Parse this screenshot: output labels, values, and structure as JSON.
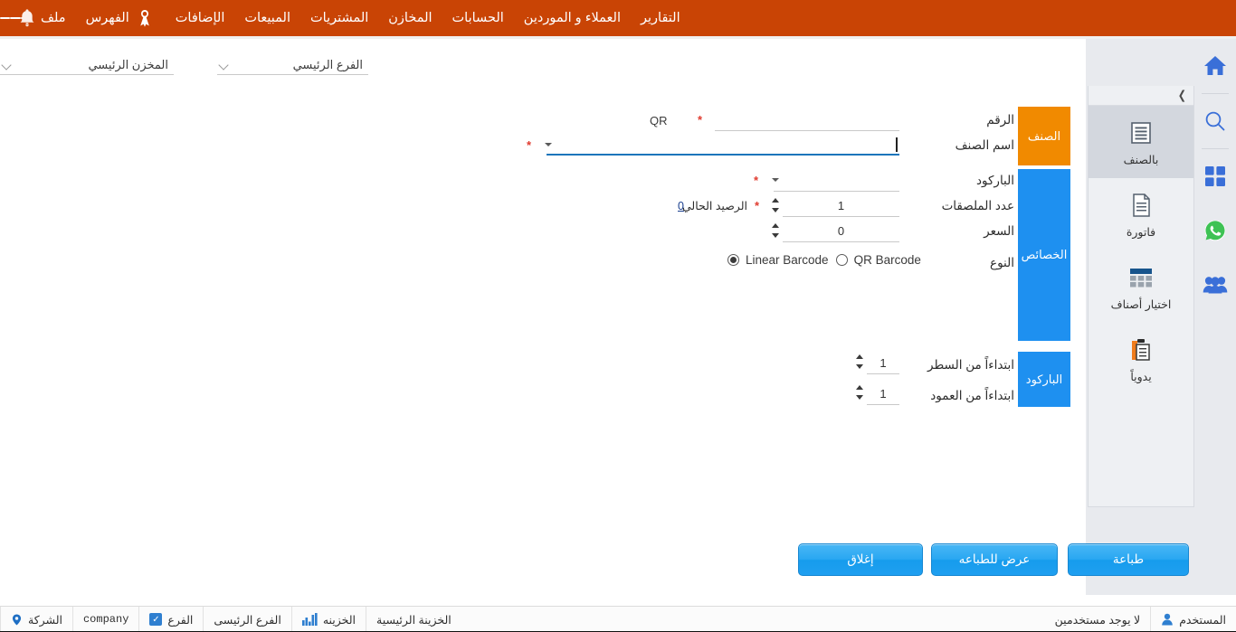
{
  "topbar": {
    "bell_icon": "bell-icon",
    "hamburger_icon": "hamburger-icon",
    "ribbon_icon": "ribbon-icon",
    "menu": [
      {
        "label": "ملف",
        "name": "menu-file"
      },
      {
        "label": "الفهرس",
        "name": "menu-index"
      },
      {
        "label": "الإضافات",
        "name": "menu-addons"
      },
      {
        "label": "المبيعات",
        "name": "menu-sales"
      },
      {
        "label": "المشتريات",
        "name": "menu-purchases"
      },
      {
        "label": "المخازن",
        "name": "menu-warehouses"
      },
      {
        "label": "الحسابات",
        "name": "menu-accounts"
      },
      {
        "label": "العملاء و الموردين",
        "name": "menu-customers-suppliers"
      },
      {
        "label": "التقارير",
        "name": "menu-reports"
      }
    ],
    "bg_color": "#C94405"
  },
  "select_row": {
    "branch": {
      "label": "الفرع الرئيسي",
      "name": "branch-select"
    },
    "store": {
      "label": "المخزن الرئيسي",
      "name": "store-select"
    },
    "third": {
      "label": "",
      "name": "extra-select"
    }
  },
  "tabs": {
    "item": {
      "label": "الصنف",
      "color": "#F18A00"
    },
    "properties": {
      "label": "الخصائص",
      "color": "#1E90F0"
    },
    "barcode": {
      "label": "الباركود",
      "color": "#1E90F0"
    }
  },
  "form": {
    "number": {
      "label": "الرقم",
      "value": "",
      "required": "*"
    },
    "qr_tag": "QR",
    "item_name": {
      "label": "اسم الصنف",
      "value": "",
      "required": "*"
    },
    "barcode": {
      "label": "الباركود",
      "value": "",
      "required": "*"
    },
    "labels_count": {
      "label": "عدد الملصقات",
      "value": "1",
      "required": "*"
    },
    "current_balance": {
      "label": "الرصيد الحالي",
      "value": "0",
      "required": "*"
    },
    "price": {
      "label": "السعر",
      "value": "0"
    },
    "type": {
      "label": "النوع",
      "options": [
        {
          "label": "Linear Barcode",
          "selected": true,
          "name": "radio-linear-barcode"
        },
        {
          "label": "QR Barcode",
          "selected": false,
          "name": "radio-qr-barcode"
        }
      ]
    },
    "start_row": {
      "label": "ابتداءاً من السطر",
      "value": "1"
    },
    "start_col": {
      "label": "ابتداءاً من العمود",
      "value": "1"
    }
  },
  "side_panel": {
    "expand_arrow": "chevron-right-icon",
    "items": [
      {
        "label": "بالصنف",
        "icon": "list-lines-icon",
        "active": true,
        "name": "panel-item-by-item"
      },
      {
        "label": "فاتورة",
        "icon": "document-icon",
        "active": false,
        "name": "panel-item-invoice"
      },
      {
        "label": "اختيار أصناف",
        "icon": "grid-table-icon",
        "active": false,
        "name": "panel-item-select-items"
      },
      {
        "label": "يدوياً",
        "icon": "clipboard-icon",
        "active": false,
        "name": "panel-item-manual"
      }
    ]
  },
  "icon_rail": [
    {
      "icon": "home-icon",
      "name": "rail-home"
    },
    {
      "icon": "search-icon",
      "name": "rail-search"
    },
    {
      "icon": "apps-grid-icon",
      "name": "rail-apps"
    },
    {
      "icon": "whatsapp-icon",
      "name": "rail-whatsapp"
    },
    {
      "icon": "users-icon",
      "name": "rail-users"
    }
  ],
  "buttons": {
    "print": {
      "label": "طباعة",
      "name": "print-button"
    },
    "preview": {
      "label": "عرض للطباعه",
      "name": "print-preview-button"
    },
    "close": {
      "label": "إغلاق",
      "name": "close-button"
    }
  },
  "statusbar": {
    "company_label": "الشركة",
    "company_value": "company",
    "branch_label": "الفرع",
    "branch_value": "الفرع الرئيسى",
    "treasury_label": "الخزينه",
    "treasury_value": "الخزينة الرئيسية",
    "user_label": "المستخدم",
    "user_value": "لا يوجد مستخدمين"
  },
  "colors": {
    "brand_orange": "#C94405",
    "tab_orange": "#F18A00",
    "tab_blue": "#1E90F0",
    "button_blue": "#2aa7f2",
    "panel_gray": "#e8eaee"
  }
}
